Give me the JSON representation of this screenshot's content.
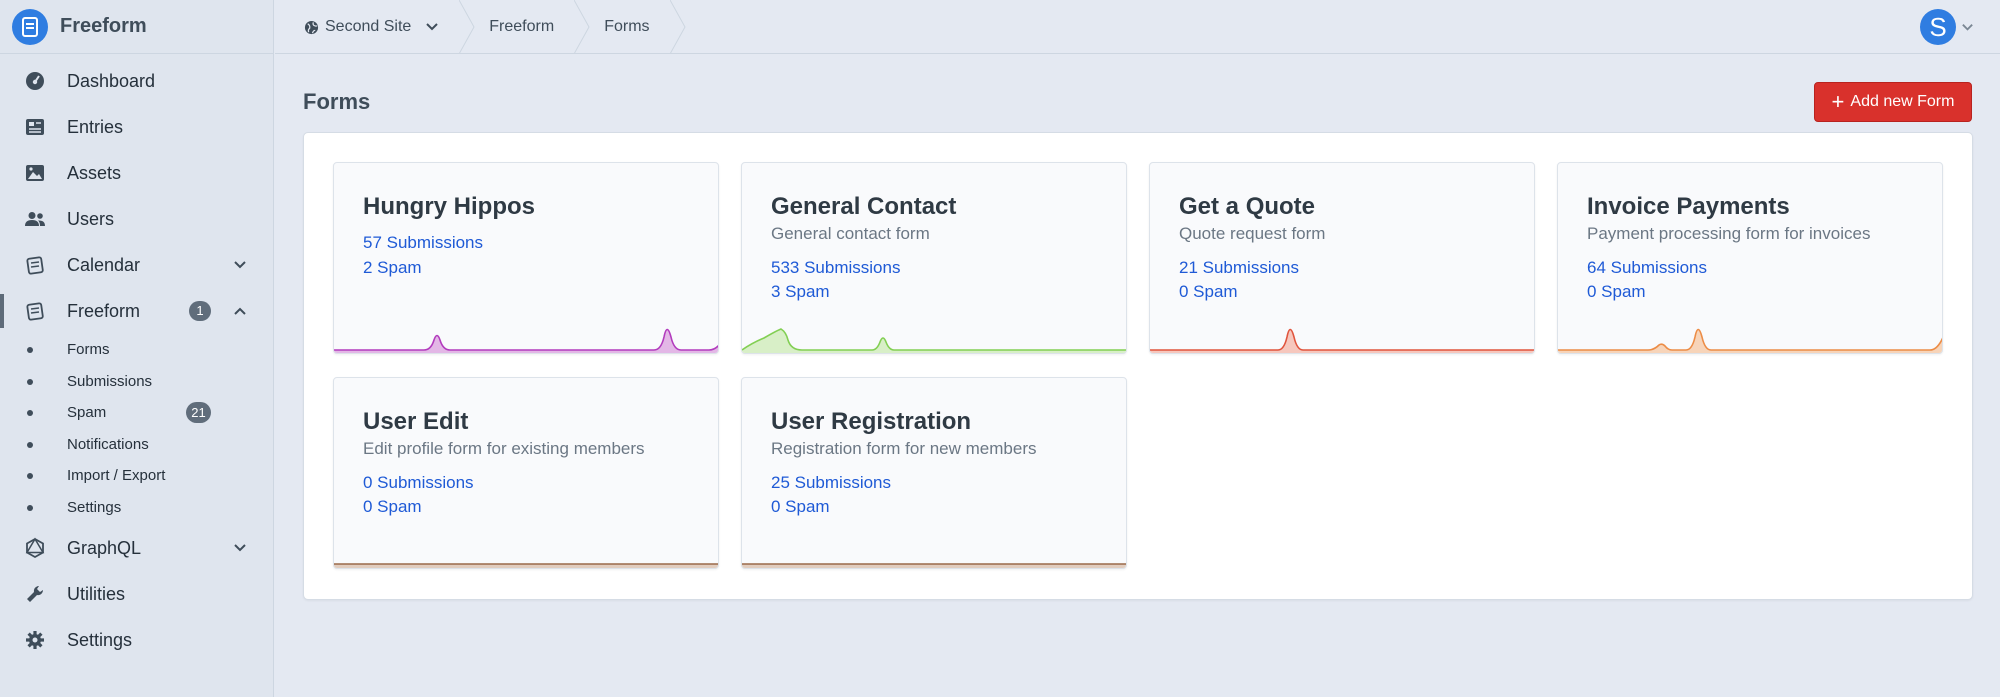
{
  "app": {
    "name": "Freeform"
  },
  "sidebar": {
    "items": [
      {
        "label": "Dashboard",
        "icon": "dashboard-icon"
      },
      {
        "label": "Entries",
        "icon": "entries-icon"
      },
      {
        "label": "Assets",
        "icon": "assets-icon"
      },
      {
        "label": "Users",
        "icon": "users-icon"
      },
      {
        "label": "Calendar",
        "icon": "calendar-icon",
        "expandable": true
      },
      {
        "label": "Freeform",
        "icon": "freeform-icon",
        "badge": "1",
        "expanded": true,
        "active": true
      },
      {
        "label": "GraphQL",
        "icon": "graphql-icon",
        "expandable": true
      },
      {
        "label": "Utilities",
        "icon": "wrench-icon"
      },
      {
        "label": "Settings",
        "icon": "gear-icon"
      }
    ],
    "subitems": [
      {
        "label": "Forms"
      },
      {
        "label": "Submissions"
      },
      {
        "label": "Spam",
        "badge": "21"
      },
      {
        "label": "Notifications"
      },
      {
        "label": "Import / Export"
      },
      {
        "label": "Settings"
      }
    ]
  },
  "header": {
    "site": "Second Site",
    "breadcrumbs": [
      "Freeform",
      "Forms"
    ],
    "avatar_letter": "S"
  },
  "page": {
    "title": "Forms",
    "add_button": "Add new Form"
  },
  "forms": [
    {
      "title": "Hungry Hippos",
      "description": "",
      "submissions": "57 Submissions",
      "spam": "2 Spam",
      "color": "#b23bbd",
      "fill": "#e3b7e6"
    },
    {
      "title": "General Contact",
      "description": "General contact form",
      "submissions": "533 Submissions",
      "spam": "3 Spam",
      "color": "#82cf53",
      "fill": "#d8efc7"
    },
    {
      "title": "Get a Quote",
      "description": "Quote request form",
      "submissions": "21 Submissions",
      "spam": "0 Spam",
      "color": "#e0543d",
      "fill": "#f6c7bd"
    },
    {
      "title": "Invoice Payments",
      "description": "Payment processing form for invoices",
      "submissions": "64 Submissions",
      "spam": "0 Spam",
      "color": "#ec8c46",
      "fill": "#f7d4b9"
    },
    {
      "title": "User Edit",
      "description": "Edit profile form for existing members",
      "submissions": "0 Submissions",
      "spam": "0 Spam",
      "color": "#9a6a4a",
      "fill": "#e1cdbf"
    },
    {
      "title": "User Registration",
      "description": "Registration form for new members",
      "submissions": "25 Submissions",
      "spam": "0 Spam",
      "color": "#9a6a4a",
      "fill": "#e1cdbf"
    }
  ]
}
